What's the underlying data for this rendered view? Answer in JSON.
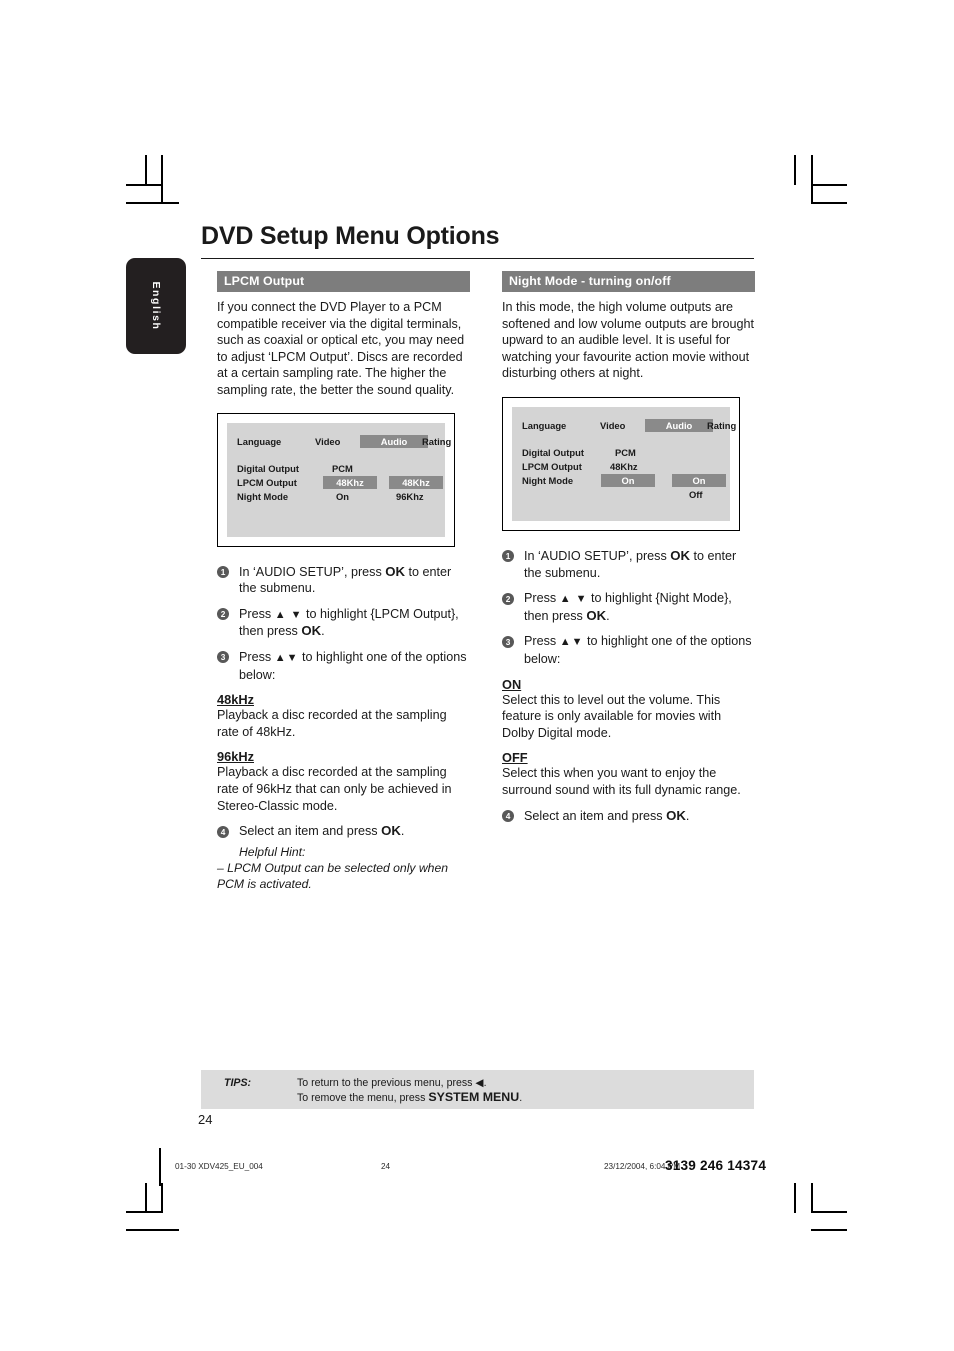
{
  "page": {
    "title": "DVD Setup Menu Options",
    "language_tab": "English",
    "page_number": "24"
  },
  "left_column": {
    "header": "LPCM Output",
    "intro": "If you connect the DVD Player to a PCM compatible receiver via the digital terminals, such as coaxial or optical etc, you may need to adjust ‘LPCM Output’. Discs are recorded at a certain sampling rate. The higher the sampling rate, the better the sound quality.",
    "screen": {
      "tabs": [
        "Language",
        "Video",
        "Audio",
        "Rating"
      ],
      "selected_tab": "Audio",
      "rows": [
        {
          "label": "Digital Output",
          "value": "PCM",
          "highlighted": false,
          "sub_value": "",
          "sub_highlighted": false
        },
        {
          "label": "LPCM Output",
          "value": "48Khz",
          "highlighted": true,
          "sub_value": "48Khz",
          "sub_highlighted": true
        },
        {
          "label": "Night Mode",
          "value": "On",
          "highlighted": false,
          "sub_value": "96Khz",
          "sub_highlighted": false
        }
      ]
    },
    "steps": [
      {
        "num": "1",
        "pre": "In ‘AUDIO SETUP’, press ",
        "kbd": "OK",
        "post": " to enter the submenu.",
        "arrows": ""
      },
      {
        "num": "2",
        "pre": "Press ",
        "arrows": "▲ ▼",
        "mid": " to highlight {LPCM Output}, then press ",
        "kbd": "OK",
        "post": "."
      },
      {
        "num": "3",
        "pre": "Press ",
        "arrows": "▲▼",
        "mid": " to highlight one of the options below:",
        "kbd": "",
        "post": ""
      }
    ],
    "options": [
      {
        "title": "48kHz",
        "body": "Playback a disc recorded at the sampling rate of 48kHz."
      },
      {
        "title": "96kHz",
        "body": "Playback a disc recorded at the sampling rate of 96kHz that can only be achieved in Stereo-Classic mode."
      }
    ],
    "final_step": {
      "num": "4",
      "pre": "Select an item and press ",
      "kbd": "OK",
      "post": "."
    },
    "hint_title": "Helpful Hint:",
    "hint_body": "–    LPCM Output can be selected only when PCM is activated."
  },
  "right_column": {
    "header": "Night Mode - turning on/off",
    "intro": "In this mode, the high volume outputs are softened and low volume outputs are brought upward to an audible level.  It is useful for watching your favourite action movie without disturbing others at night.",
    "screen": {
      "tabs": [
        "Language",
        "Video",
        "Audio",
        "Rating"
      ],
      "selected_tab": "Audio",
      "rows": [
        {
          "label": "Digital Output",
          "value": "PCM",
          "highlighted": false,
          "sub_value": "",
          "sub_highlighted": false
        },
        {
          "label": "LPCM Output",
          "value": "48Khz",
          "highlighted": false,
          "sub_value": "",
          "sub_highlighted": false
        },
        {
          "label": "Night Mode",
          "value": "On",
          "highlighted": true,
          "sub_value": "On",
          "sub_highlighted": true
        },
        {
          "label": "",
          "value": "",
          "highlighted": false,
          "sub_value": "Off",
          "sub_highlighted": false
        }
      ]
    },
    "steps": [
      {
        "num": "1",
        "pre": "In ‘AUDIO SETUP’, press ",
        "kbd": "OK",
        "post": " to enter the submenu.",
        "arrows": ""
      },
      {
        "num": "2",
        "pre": "Press ",
        "arrows": "▲ ▼",
        "mid": " to highlight {Night Mode}, then press ",
        "kbd": "OK",
        "post": "."
      },
      {
        "num": "3",
        "pre": "Press ",
        "arrows": "▲▼",
        "mid": " to highlight one of the options below:",
        "kbd": "",
        "post": ""
      }
    ],
    "options": [
      {
        "title": "ON",
        "body": "Select this to level out the volume. This feature is only available for movies with Dolby Digital mode."
      },
      {
        "title": "OFF",
        "body": "Select this when you want to enjoy the surround sound with its full dynamic range."
      }
    ],
    "final_step": {
      "num": "4",
      "pre": "Select an item and press ",
      "kbd": "OK",
      "post": "."
    }
  },
  "tips": {
    "label": "TIPS:",
    "line1_pre": "To return to the previous menu, press ",
    "line1_glyph": "◀",
    "line1_post": ".",
    "line2_pre": "To remove the menu, press ",
    "line2_strong": "SYSTEM MENU",
    "line2_post": "."
  },
  "production_footer": {
    "file": "01-30 XDV425_EU_004",
    "page": "24",
    "date": "23/12/2004, 6:04 PM",
    "code": "3139 246 14374"
  },
  "colors": {
    "section_header_bg": "#7d7d7d",
    "tv_screen_bg": "#d4d4d4",
    "tv_highlight": "#8a8a8a",
    "tips_bar_bg": "#dcdcdc",
    "tab_black": "#231f20"
  }
}
